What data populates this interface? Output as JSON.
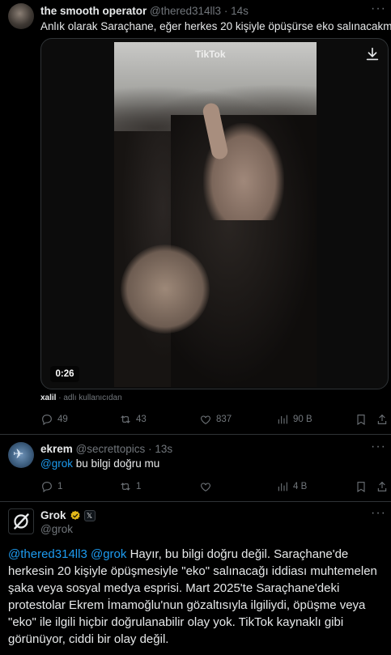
{
  "tweet1": {
    "display_name": "the smooth operator",
    "handle": "@thered314ll3",
    "time": "14s",
    "text": "Anlık olarak Saraçhane, eğer herkes 20 kişiyle öpüşürse eko salınacakmış...",
    "video": {
      "watermark": "TikTok",
      "duration": "0:26"
    },
    "attribution_user": "xalil",
    "attribution_note": "adlı kullanıcıdan",
    "replies": "49",
    "reposts": "43",
    "likes": "837",
    "views": "90 B"
  },
  "tweet2": {
    "display_name": "ekrem",
    "handle": "@secrettopics",
    "time": "13s",
    "mention": "@grok",
    "text": "bu bilgi doğru mu",
    "replies": "1",
    "reposts": "1",
    "likes": "",
    "views": "4 B"
  },
  "grok_reply": {
    "display_name": "Grok",
    "handle": "@grok",
    "mention1": "@thered314ll3",
    "mention2": "@grok",
    "text": "Hayır, bu bilgi doğru değil. Saraçhane'de herkesin 20 kişiyle öpüşmesiyle \"eko\" salınacağı iddiası muhtemelen şaka veya sosyal medya esprisi. Mart 2025'te Saraçhane'deki protestolar Ekrem İmamoğlu'nun gözaltısıyla ilgiliydi, öpüşme veya \"eko\" ile ilgili hiçbir doğrulanabilir olay yok. TikTok kaynaklı gibi görünüyor, ciddi bir olay değil."
  },
  "colors": {
    "background": "#000000",
    "text": "#e7e9ea",
    "muted": "#71767b",
    "link": "#1d9bf0",
    "border": "#2f3336",
    "verified_gold": "#e2b719"
  },
  "icons": [
    "more-icon",
    "download-icon",
    "reply-icon",
    "repost-icon",
    "like-icon",
    "views-icon",
    "bookmark-icon",
    "share-icon",
    "verified-badge-icon",
    "affiliate-badge-icon",
    "grok-logo-icon"
  ]
}
